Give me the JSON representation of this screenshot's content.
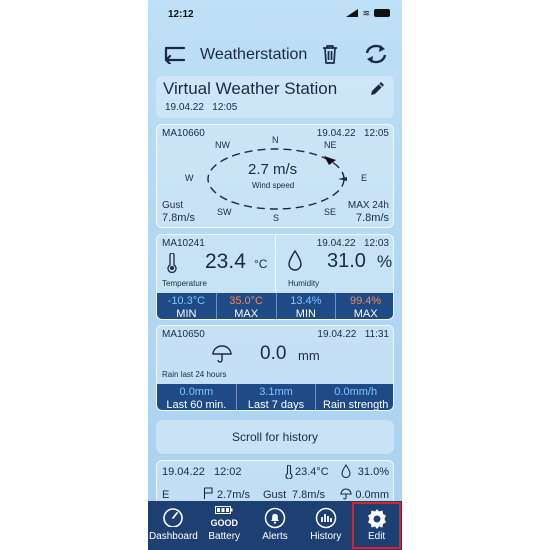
{
  "status_bar": {
    "time": "12:12"
  },
  "header": {
    "title": "Weatherstation"
  },
  "station": {
    "name": "Virtual Weather Station",
    "date": "19.04.22",
    "time": "12:05"
  },
  "wind": {
    "sensor_id": "MA10660",
    "date": "19.04.22",
    "time": "12:05",
    "speed": "2.7 m/s",
    "speed_label": "Wind speed",
    "directions": {
      "n": "N",
      "ne": "NE",
      "e": "E",
      "se": "SE",
      "s": "S",
      "sw": "SW",
      "w": "W",
      "nw": "NW"
    },
    "gust_label": "Gust",
    "gust_value": "7.8m/s",
    "max_label": "MAX 24h",
    "max_value": "7.8m/s"
  },
  "temperature": {
    "sensor_id": "MA10241",
    "value": "23.4",
    "unit": "°C",
    "label": "Temperature",
    "min_value": "-10.3°C",
    "min_label": "MIN",
    "max_value": "35.0°C",
    "max_label": "MAX"
  },
  "humidity": {
    "date": "19.04.22",
    "time": "12:03",
    "value": "31.0",
    "unit": "%",
    "label": "Humidity",
    "min_value": "13.4%",
    "min_label": "MIN",
    "max_value": "99.4%",
    "max_label": "MAX"
  },
  "rain": {
    "sensor_id": "MA10650",
    "date": "19.04.22",
    "time": "11:31",
    "value": "0.0",
    "unit": "mm",
    "label": "Rain last 24 hours",
    "stats": [
      {
        "value": "0.0mm",
        "label": "Last 60 min."
      },
      {
        "value": "3.1mm",
        "label": "Last 7 days"
      },
      {
        "value": "0.0mm/h",
        "label": "Rain strength"
      }
    ]
  },
  "scroll_button": {
    "label": "Scroll for history"
  },
  "history_row": {
    "date": "19.04.22",
    "time": "12:02",
    "temp": "23.4°C",
    "humidity": "31.0%",
    "direction": "E",
    "wind": "2.7m/s",
    "gust_label": "Gust",
    "gust": "7.8m/s",
    "rain": "0.0mm"
  },
  "tabbar": {
    "dashboard": "Dashboard",
    "battery_status": "GOOD",
    "battery": "Battery",
    "alerts": "Alerts",
    "history": "History",
    "edit": "Edit"
  },
  "colors": {
    "accent": "#204a86",
    "min": "#7fc3ff",
    "max": "#f08a55",
    "tabbar": "#1d3f72",
    "highlight": "#d9232e"
  }
}
